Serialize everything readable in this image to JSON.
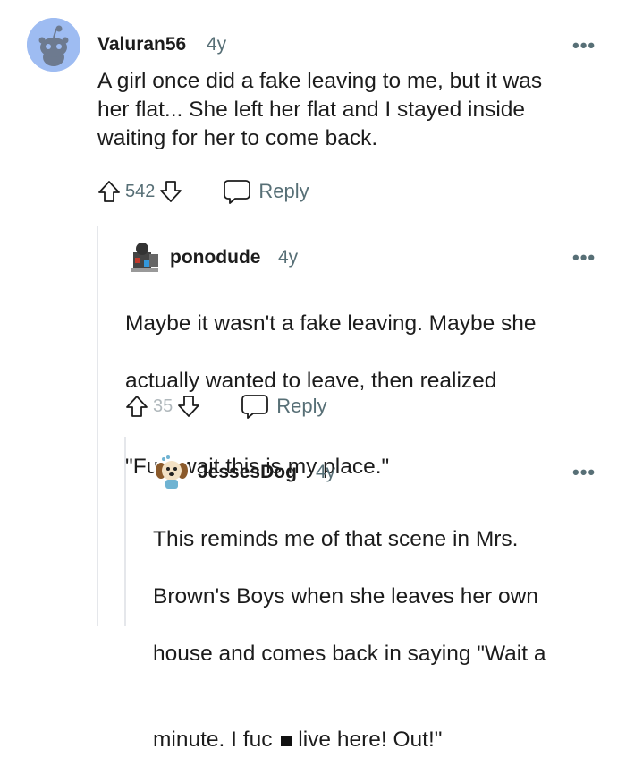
{
  "comments": [
    {
      "username": "Valuran56",
      "time": "4y",
      "more": "•••",
      "text": "A girl once did a fake leaving to me, but it was\nher flat... She left her flat and I stayed inside\nwaiting for her to come back.",
      "score": "542",
      "reply_label": "Reply"
    },
    {
      "username": "ponodude",
      "time": "4y",
      "more": "•••",
      "text_lines": [
        "Maybe it wasn't a fake leaving. Maybe she",
        "actually wanted to leave, then realized"
      ],
      "text_line3_prefix": "\"Fu",
      "text_line3_suffix": ", wait this is my place.\"",
      "score": "35",
      "reply_label": "Reply"
    },
    {
      "username": "JessesDog",
      "time": "4y",
      "more": "•••",
      "text_lines": [
        "This reminds me of that scene in Mrs.",
        "Brown's Boys when she leaves her own",
        "house and comes back in saying \"Wait a"
      ],
      "text_line4_prefix": "minute. I fuc",
      "text_line4_suffix": " live here! Out!\""
    }
  ]
}
